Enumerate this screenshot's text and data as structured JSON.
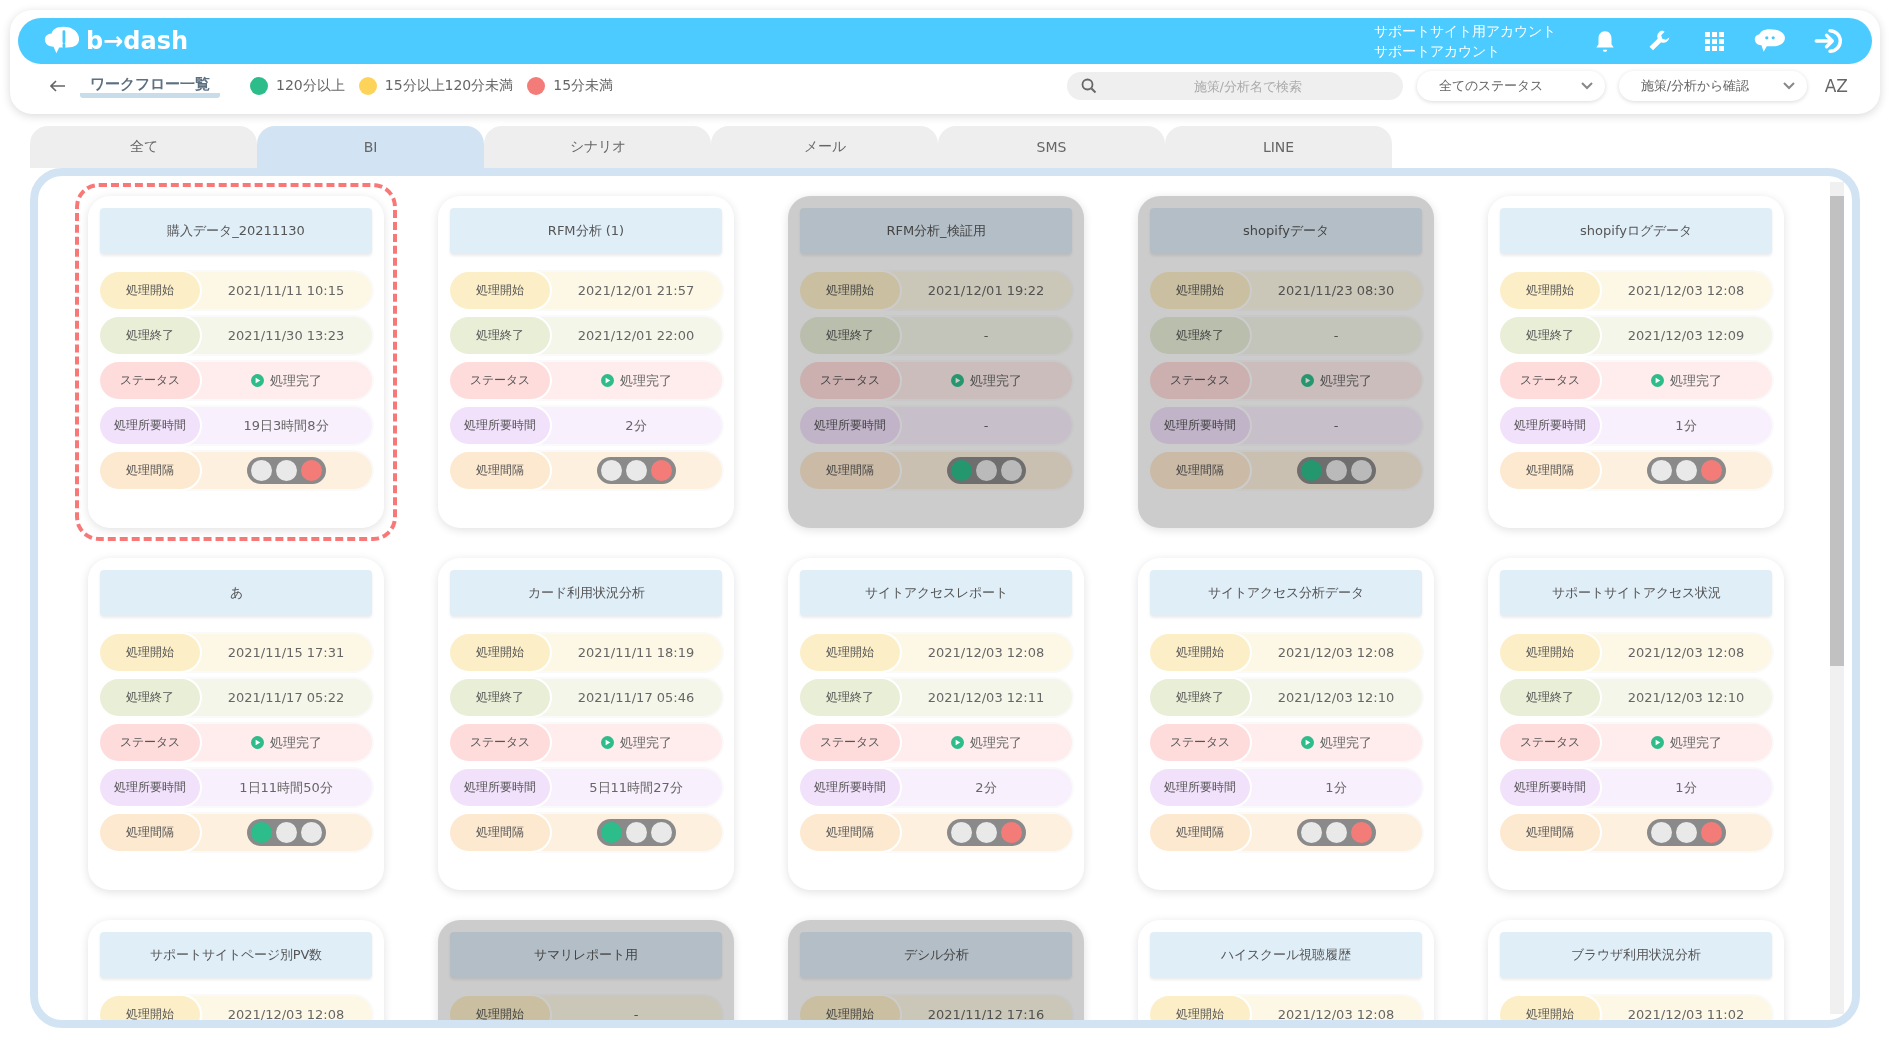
{
  "header": {
    "brand": "b→dash",
    "account_lines": [
      "サポートサイト用アカウント",
      "サポートアカウント"
    ]
  },
  "toolbar": {
    "title": "ワークフロー一覧",
    "legend": [
      {
        "label": "120分以上",
        "color": "#2dbd8a"
      },
      {
        "label": "15分以上120分未満",
        "color": "#fdd35a"
      },
      {
        "label": "15分未満",
        "color": "#f47c78"
      }
    ],
    "search": {
      "placeholder": "施策/分析名で検索"
    },
    "status_select": "全てのステータス",
    "source_select": "施策/分析から確認",
    "sort_label": "AZ"
  },
  "tabs": [
    {
      "label": "全て",
      "selected": false
    },
    {
      "label": "BI",
      "selected": true
    },
    {
      "label": "シナリオ",
      "selected": false
    },
    {
      "label": "メール",
      "selected": false
    },
    {
      "label": "SMS",
      "selected": false
    },
    {
      "label": "LINE",
      "selected": false
    }
  ],
  "cards": [
    {
      "title": "購入データ_20211130",
      "selected": true,
      "disabled": false,
      "rows": [
        {
          "kind": "start",
          "label": "処理開始",
          "value": "2021/11/11 10:15"
        },
        {
          "kind": "end",
          "label": "処理終了",
          "value": "2021/11/30 13:23"
        },
        {
          "kind": "status",
          "label": "ステータス",
          "value": "処理完了"
        },
        {
          "kind": "duration",
          "label": "処理所要時間",
          "value": "19日3時間8分"
        },
        {
          "kind": "interval",
          "label": "処理間隔",
          "lamps": [
            {
              "on": false
            },
            {
              "on": false
            },
            {
              "on": true
            }
          ]
        }
      ]
    },
    {
      "title": "RFM分析 (1)",
      "selected": false,
      "disabled": false,
      "rows": [
        {
          "kind": "start",
          "label": "処理開始",
          "value": "2021/12/01 21:57"
        },
        {
          "kind": "end",
          "label": "処理終了",
          "value": "2021/12/01 22:00"
        },
        {
          "kind": "status",
          "label": "ステータス",
          "value": "処理完了"
        },
        {
          "kind": "duration",
          "label": "処理所要時間",
          "value": "2分"
        },
        {
          "kind": "interval",
          "label": "処理間隔",
          "lamps": [
            {
              "on": false
            },
            {
              "on": false
            },
            {
              "on": true
            }
          ]
        }
      ]
    },
    {
      "title": "RFM分析_検証用",
      "selected": false,
      "disabled": true,
      "rows": [
        {
          "kind": "start",
          "label": "処理開始",
          "value": "2021/12/01 19:22"
        },
        {
          "kind": "end",
          "label": "処理終了",
          "value": "-"
        },
        {
          "kind": "status",
          "label": "ステータス",
          "value": "処理完了"
        },
        {
          "kind": "duration",
          "label": "処理所要時間",
          "value": "-"
        },
        {
          "kind": "interval",
          "label": "処理間隔",
          "lamps": [
            {
              "on": true
            },
            {
              "on": false
            },
            {
              "on": false
            }
          ]
        }
      ]
    },
    {
      "title": "shopifyデータ",
      "selected": false,
      "disabled": true,
      "rows": [
        {
          "kind": "start",
          "label": "処理開始",
          "value": "2021/11/23 08:30"
        },
        {
          "kind": "end",
          "label": "処理終了",
          "value": "-"
        },
        {
          "kind": "status",
          "label": "ステータス",
          "value": "処理完了"
        },
        {
          "kind": "duration",
          "label": "処理所要時間",
          "value": "-"
        },
        {
          "kind": "interval",
          "label": "処理間隔",
          "lamps": [
            {
              "on": true
            },
            {
              "on": false
            },
            {
              "on": false
            }
          ]
        }
      ]
    },
    {
      "title": "shopifyログデータ",
      "selected": false,
      "disabled": false,
      "rows": [
        {
          "kind": "start",
          "label": "処理開始",
          "value": "2021/12/03 12:08"
        },
        {
          "kind": "end",
          "label": "処理終了",
          "value": "2021/12/03 12:09"
        },
        {
          "kind": "status",
          "label": "ステータス",
          "value": "処理完了"
        },
        {
          "kind": "duration",
          "label": "処理所要時間",
          "value": "1分"
        },
        {
          "kind": "interval",
          "label": "処理間隔",
          "lamps": [
            {
              "on": false
            },
            {
              "on": false
            },
            {
              "on": true
            }
          ]
        }
      ]
    },
    {
      "title": "あ",
      "selected": false,
      "disabled": false,
      "rows": [
        {
          "kind": "start",
          "label": "処理開始",
          "value": "2021/11/15 17:31"
        },
        {
          "kind": "end",
          "label": "処理終了",
          "value": "2021/11/17 05:22"
        },
        {
          "kind": "status",
          "label": "ステータス",
          "value": "処理完了"
        },
        {
          "kind": "duration",
          "label": "処理所要時間",
          "value": "1日11時間50分"
        },
        {
          "kind": "interval",
          "label": "処理間隔",
          "lamps": [
            {
              "on": true
            },
            {
              "on": false
            },
            {
              "on": false
            }
          ]
        }
      ]
    },
    {
      "title": "カード利用状況分析",
      "selected": false,
      "disabled": false,
      "rows": [
        {
          "kind": "start",
          "label": "処理開始",
          "value": "2021/11/11 18:19"
        },
        {
          "kind": "end",
          "label": "処理終了",
          "value": "2021/11/17 05:46"
        },
        {
          "kind": "status",
          "label": "ステータス",
          "value": "処理完了"
        },
        {
          "kind": "duration",
          "label": "処理所要時間",
          "value": "5日11時間27分"
        },
        {
          "kind": "interval",
          "label": "処理間隔",
          "lamps": [
            {
              "on": true
            },
            {
              "on": false
            },
            {
              "on": false
            }
          ]
        }
      ]
    },
    {
      "title": "サイトアクセスレポート",
      "selected": false,
      "disabled": false,
      "rows": [
        {
          "kind": "start",
          "label": "処理開始",
          "value": "2021/12/03 12:08"
        },
        {
          "kind": "end",
          "label": "処理終了",
          "value": "2021/12/03 12:11"
        },
        {
          "kind": "status",
          "label": "ステータス",
          "value": "処理完了"
        },
        {
          "kind": "duration",
          "label": "処理所要時間",
          "value": "2分"
        },
        {
          "kind": "interval",
          "label": "処理間隔",
          "lamps": [
            {
              "on": false
            },
            {
              "on": false
            },
            {
              "on": true
            }
          ]
        }
      ]
    },
    {
      "title": "サイトアクセス分析データ",
      "selected": false,
      "disabled": false,
      "rows": [
        {
          "kind": "start",
          "label": "処理開始",
          "value": "2021/12/03 12:08"
        },
        {
          "kind": "end",
          "label": "処理終了",
          "value": "2021/12/03 12:10"
        },
        {
          "kind": "status",
          "label": "ステータス",
          "value": "処理完了"
        },
        {
          "kind": "duration",
          "label": "処理所要時間",
          "value": "1分"
        },
        {
          "kind": "interval",
          "label": "処理間隔",
          "lamps": [
            {
              "on": false
            },
            {
              "on": false
            },
            {
              "on": true
            }
          ]
        }
      ]
    },
    {
      "title": "サポートサイトアクセス状況",
      "selected": false,
      "disabled": false,
      "rows": [
        {
          "kind": "start",
          "label": "処理開始",
          "value": "2021/12/03 12:08"
        },
        {
          "kind": "end",
          "label": "処理終了",
          "value": "2021/12/03 12:10"
        },
        {
          "kind": "status",
          "label": "ステータス",
          "value": "処理完了"
        },
        {
          "kind": "duration",
          "label": "処理所要時間",
          "value": "1分"
        },
        {
          "kind": "interval",
          "label": "処理間隔",
          "lamps": [
            {
              "on": false
            },
            {
              "on": false
            },
            {
              "on": true
            }
          ]
        }
      ]
    },
    {
      "title": "サポートサイトページ別PV数",
      "selected": false,
      "disabled": false,
      "rows": [
        {
          "kind": "start",
          "label": "処理開始",
          "value": "2021/12/03 12:08"
        }
      ]
    },
    {
      "title": "サマリレポート用",
      "selected": false,
      "disabled": true,
      "rows": [
        {
          "kind": "start",
          "label": "処理開始",
          "value": "-"
        }
      ]
    },
    {
      "title": "デシル分析",
      "selected": false,
      "disabled": true,
      "rows": [
        {
          "kind": "start",
          "label": "処理開始",
          "value": "2021/11/12 17:16"
        }
      ]
    },
    {
      "title": "ハイスクール視聴履歴",
      "selected": false,
      "disabled": false,
      "rows": [
        {
          "kind": "start",
          "label": "処理開始",
          "value": "2021/12/03 12:08"
        }
      ]
    },
    {
      "title": "ブラウザ利用状況分析",
      "selected": false,
      "disabled": false,
      "rows": [
        {
          "kind": "start",
          "label": "処理開始",
          "value": "2021/12/03 11:02"
        }
      ]
    }
  ]
}
